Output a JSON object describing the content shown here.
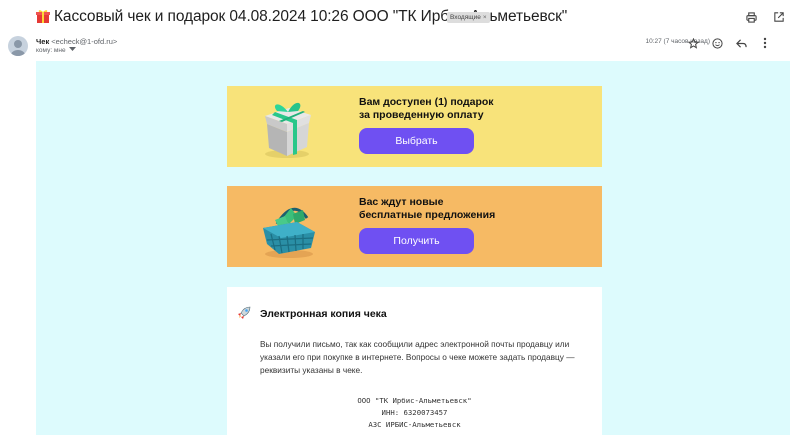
{
  "subject": {
    "title": "Кассовый чек и подарок 04.08.2024 10:26 ООО \"ТК Ирбис-Альметьевск\"",
    "label": "Входящие",
    "label_close": "×"
  },
  "sender": {
    "name": "Чек",
    "email": "<echeck@1-ofd.ru>",
    "to_label": "кому: мне",
    "time": "10:27 (7 часов назад)"
  },
  "cards": {
    "gift": {
      "title_line1": "Вам доступен (1) подарок",
      "title_line2": "за проведенную оплату",
      "button": "Выбрать"
    },
    "offers": {
      "title_line1": "Вас ждут новые",
      "title_line2": "бесплатные предложения",
      "button": "Получить"
    }
  },
  "receipt": {
    "title": "Электронная копия чека",
    "text": "Вы получили письмо, так как сообщили адрес электронной почты продавцу или указали его при покупке в интернете. Вопросы о чеке можете задать продавцу — реквизиты указаны в чеке.",
    "org": "ООО \"ТК Ирбис-Альметьевск\"",
    "inn": "ИНН: 6320073457",
    "azs": "АЗС ИРБИС-Альметьевск"
  },
  "colors": {
    "body_bg": "#ddfbfd",
    "gift_card": "#f8e37a",
    "offers_card": "#f6ba64",
    "button": "#6f50f2"
  },
  "icons": [
    "gift-emoji-icon",
    "print-icon",
    "open-new-window-icon",
    "star-icon",
    "emoji-icon",
    "reply-icon",
    "more-icon",
    "chevron-down-icon",
    "rocket-icon"
  ]
}
